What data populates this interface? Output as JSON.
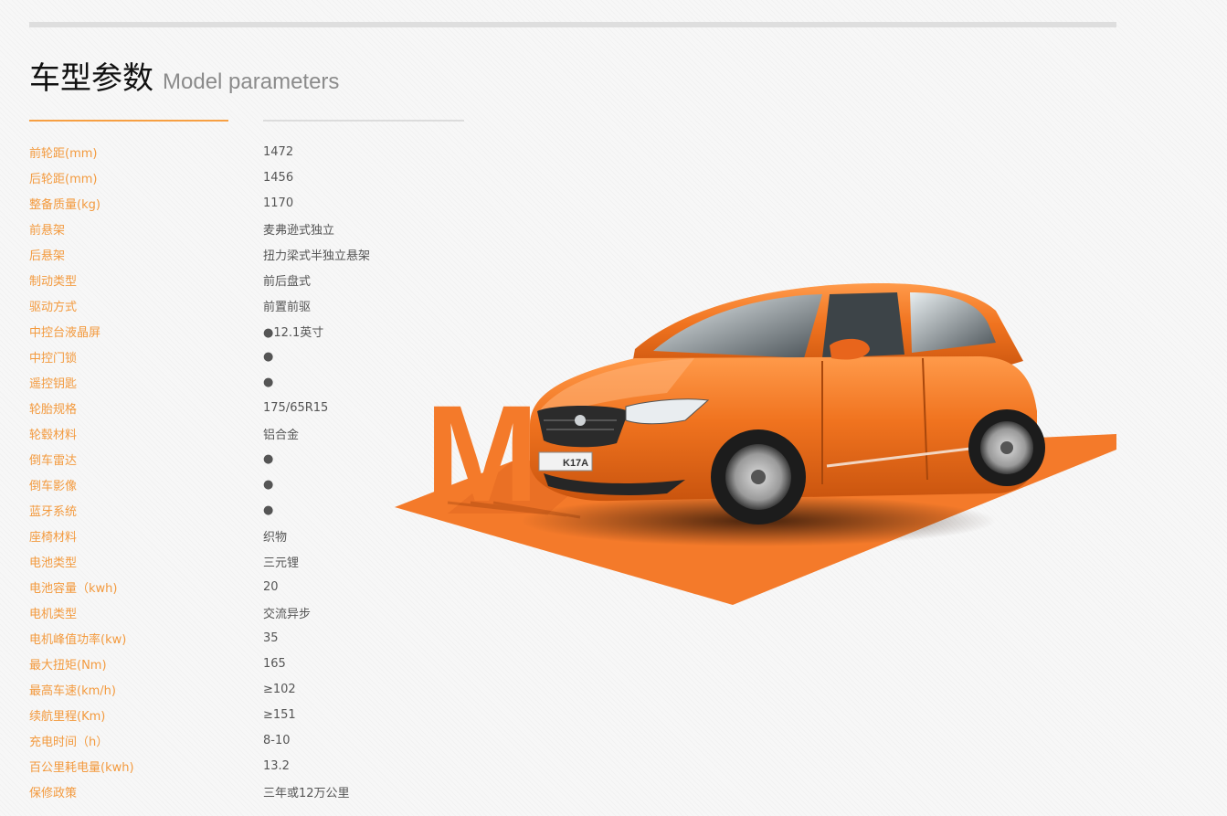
{
  "section": {
    "title_cn": "车型参数",
    "title_en": "Model parameters"
  },
  "specs": [
    {
      "label": "前轮距(mm)",
      "value": "1472"
    },
    {
      "label": "后轮距(mm)",
      "value": "1456"
    },
    {
      "label": "整备质量(kg)",
      "value": "1170"
    },
    {
      "label": "前悬架",
      "value": "麦弗逊式独立"
    },
    {
      "label": "后悬架",
      "value": "扭力梁式半独立悬架"
    },
    {
      "label": "制动类型",
      "value": "前后盘式"
    },
    {
      "label": "驱动方式",
      "value": "前置前驱"
    },
    {
      "label": "中控台液晶屏",
      "value": "●12.1英寸"
    },
    {
      "label": "中控门锁",
      "value": "●"
    },
    {
      "label": "遥控钥匙",
      "value": "●"
    },
    {
      "label": "轮胎规格",
      "value": "175/65R15"
    },
    {
      "label": "轮毂材料",
      "value": "铝合金"
    },
    {
      "label": "倒车雷达",
      "value": "●"
    },
    {
      "label": "倒车影像",
      "value": "●"
    },
    {
      "label": "蓝牙系统",
      "value": "●"
    },
    {
      "label": "座椅材料",
      "value": "织物"
    },
    {
      "label": "电池类型",
      "value": "三元锂"
    },
    {
      "label": "电池容量（kwh)",
      "value": "20"
    },
    {
      "label": "电机类型",
      "value": "交流异步"
    },
    {
      "label": "电机峰值功率(kw)",
      "value": "35"
    },
    {
      "label": "最大扭矩(Nm)",
      "value": "165"
    },
    {
      "label": "最高车速(km/h)",
      "value": "≥102"
    },
    {
      "label": "续航里程(Km)",
      "value": "≥151"
    },
    {
      "label": "充电时间（h）",
      "value": "8-10"
    },
    {
      "label": "百公里耗电量(kwh)",
      "value": "13.2"
    },
    {
      "label": "保修政策",
      "value": "三年或12万公里"
    }
  ],
  "illustration": {
    "letter": "M",
    "plate_text": "K17A",
    "accent_color": "#f47a2a",
    "label_color": "#f39a3e"
  }
}
